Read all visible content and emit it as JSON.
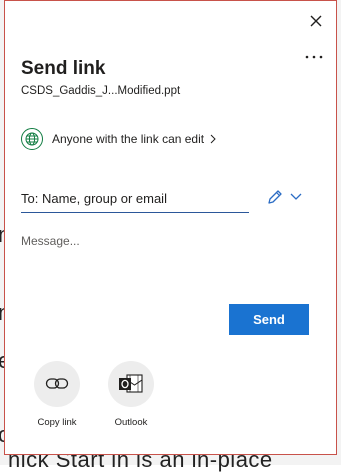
{
  "background": {
    "line1": "n",
    "line2": "n",
    "line3": "e",
    "line4": "c",
    "line5": "nick Start in is an in-place"
  },
  "dialog": {
    "title": "Send link",
    "filename": "CSDS_Gaddis_J...Modified.ppt",
    "permission": "Anyone with the link can edit",
    "to_placeholder": "To: Name, group or email",
    "message_placeholder": "Message...",
    "send_label": "Send",
    "options": [
      {
        "label": "Copy link",
        "icon": "copy-link-icon"
      },
      {
        "label": "Outlook",
        "icon": "outlook-icon"
      }
    ]
  },
  "colors": {
    "accent": "#1a73d1",
    "globe": "#107c41",
    "border": "#c8524a"
  }
}
